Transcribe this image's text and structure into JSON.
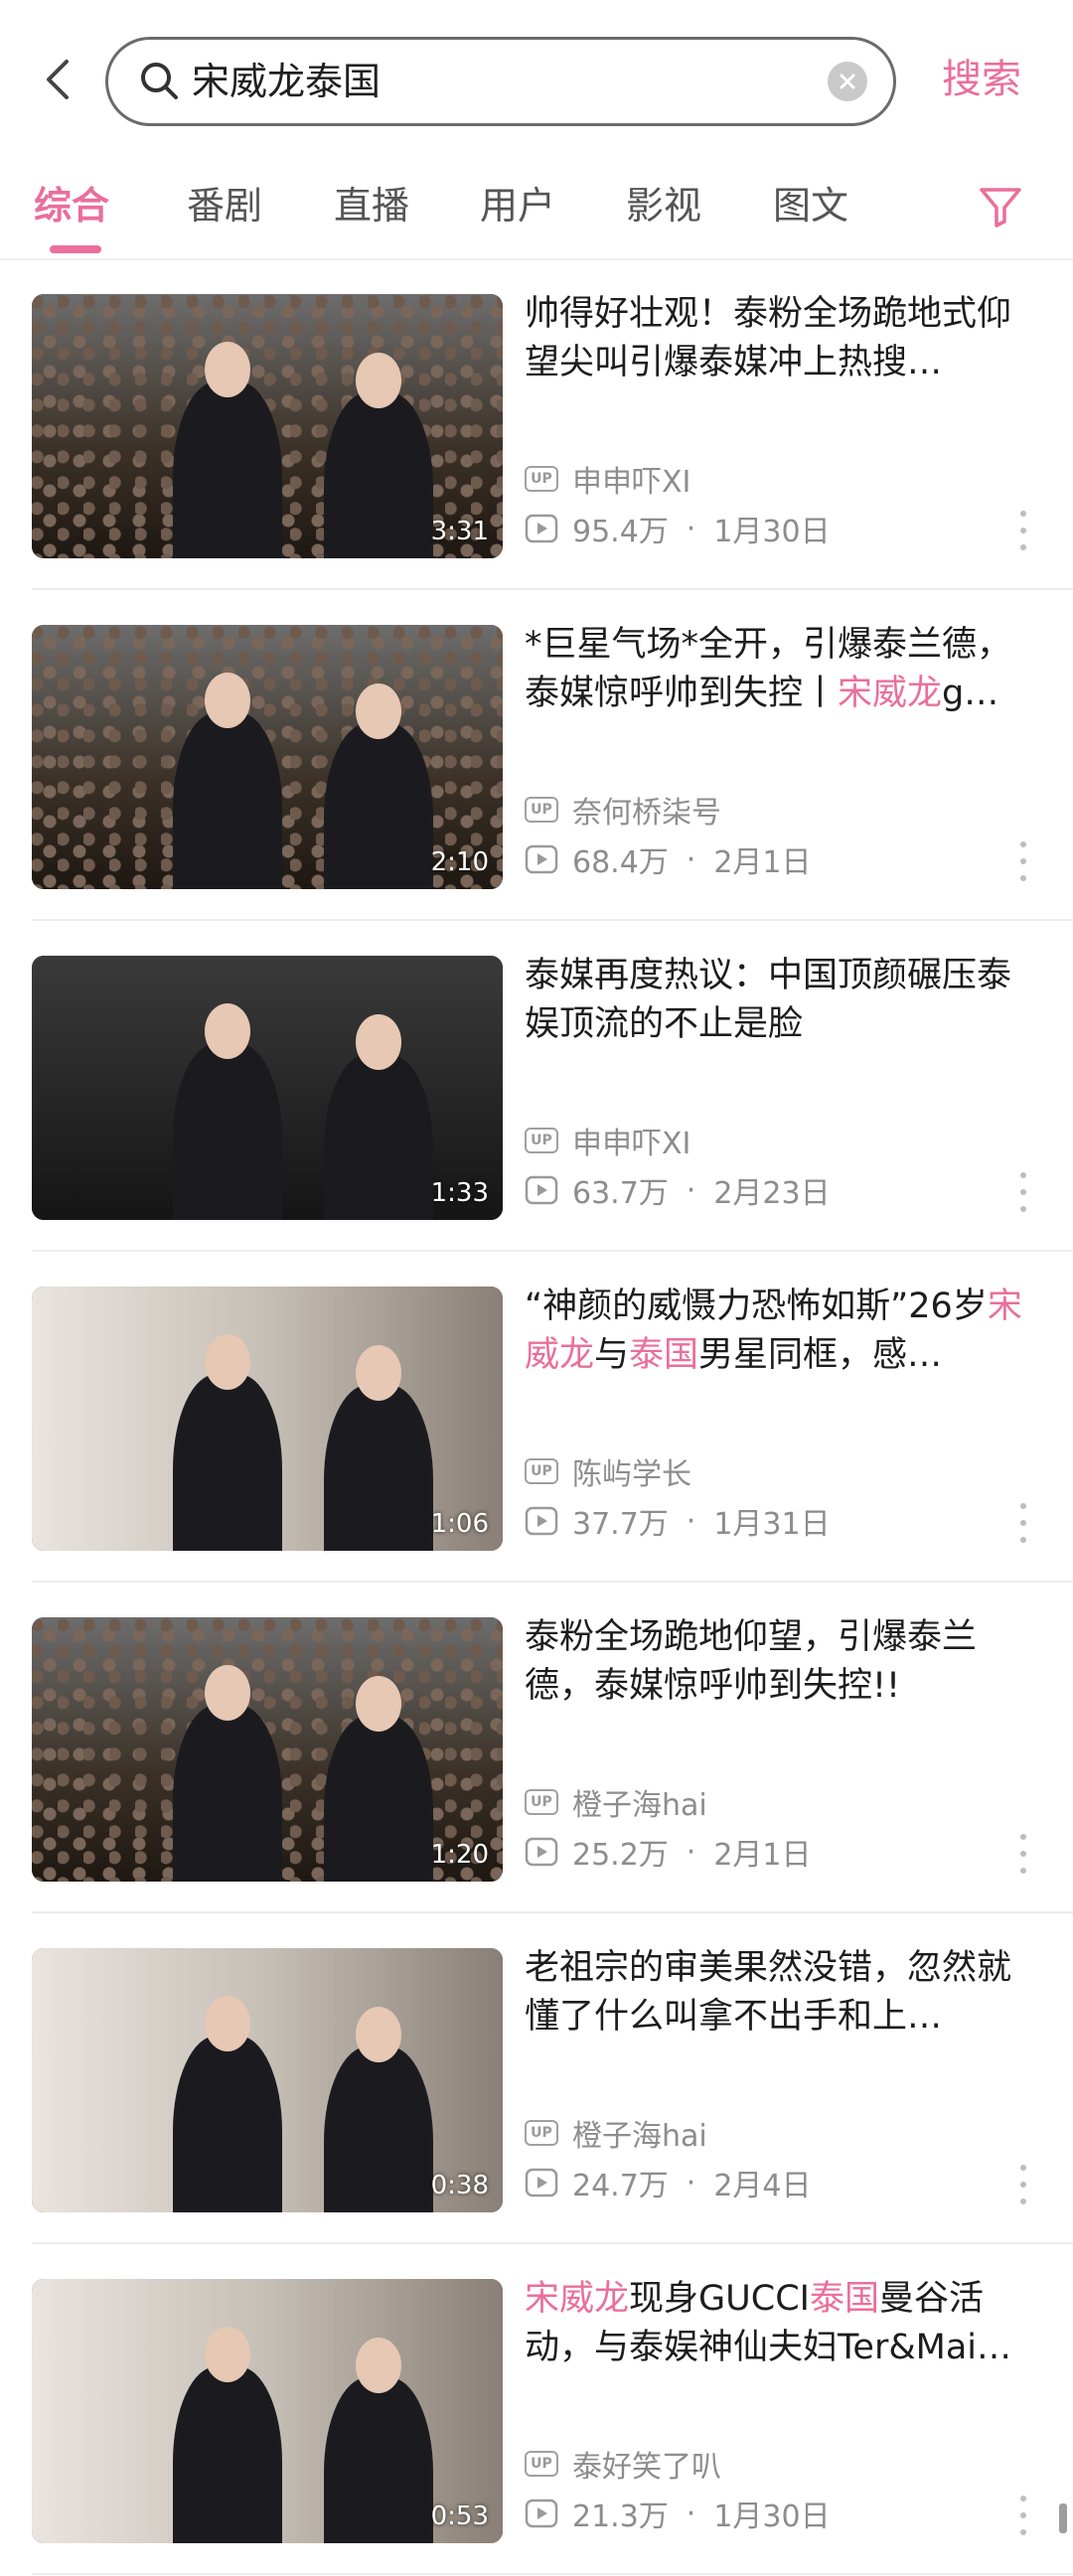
{
  "header": {
    "search_query": "宋威龙泰国",
    "search_button": "搜索"
  },
  "tabs": [
    {
      "label": "综合",
      "active": true
    },
    {
      "label": "番剧"
    },
    {
      "label": "直播"
    },
    {
      "label": "用户"
    },
    {
      "label": "影视"
    },
    {
      "label": "图文"
    }
  ],
  "accent_color": "#ea6f9b",
  "videos": [
    {
      "title": "帅得好壮观！泰粉全场跪地式仰望尖叫引爆泰媒冲上热搜…",
      "title_parts": [
        {
          "t": "帅得好壮观！泰粉全场跪地式仰望尖叫引爆泰媒冲上热搜…"
        }
      ],
      "duration": "3:31",
      "author": "申申吓XI",
      "views": "95.4万",
      "date": "1月30日"
    },
    {
      "title_parts": [
        {
          "t": "*巨星气场*全开，引爆泰兰德，泰媒惊呼帅到失控丨"
        },
        {
          "t": "宋威龙",
          "hl": true
        },
        {
          "t": "g…"
        }
      ],
      "duration": "2:10",
      "author": "奈何桥柒号",
      "views": "68.4万",
      "date": "2月1日"
    },
    {
      "title_parts": [
        {
          "t": "泰媒再度热议：中国顶颜碾压泰娱顶流的不止是脸"
        }
      ],
      "duration": "1:33",
      "author": "申申吓XI",
      "views": "63.7万",
      "date": "2月23日"
    },
    {
      "title_parts": [
        {
          "t": "“神颜的威慑力恐怖如斯”26岁"
        },
        {
          "t": "宋威龙",
          "hl": true
        },
        {
          "t": "与"
        },
        {
          "t": "泰国",
          "hl": true
        },
        {
          "t": "男星同框，感…"
        }
      ],
      "duration": "1:06",
      "author": "陈屿学长",
      "views": "37.7万",
      "date": "1月31日"
    },
    {
      "title_parts": [
        {
          "t": "泰粉全场跪地仰望，引爆泰兰德，泰媒惊呼帅到失控!!"
        }
      ],
      "duration": "1:20",
      "author": "橙子海hai",
      "views": "25.2万",
      "date": "2月1日"
    },
    {
      "title_parts": [
        {
          "t": "老祖宗的审美果然没错，忽然就懂了什么叫拿不出手和上…"
        }
      ],
      "duration": "0:38",
      "author": "橙子海hai",
      "views": "24.7万",
      "date": "2月4日"
    },
    {
      "title_parts": [
        {
          "t": "宋威龙",
          "hl": true
        },
        {
          "t": "现身GUCCI"
        },
        {
          "t": "泰国",
          "hl": true
        },
        {
          "t": "曼谷活动，与泰娱神仙夫妇Ter&Mai…"
        }
      ],
      "duration": "0:53",
      "author": "泰好笑了叭",
      "views": "21.3万",
      "date": "1月30日"
    }
  ]
}
